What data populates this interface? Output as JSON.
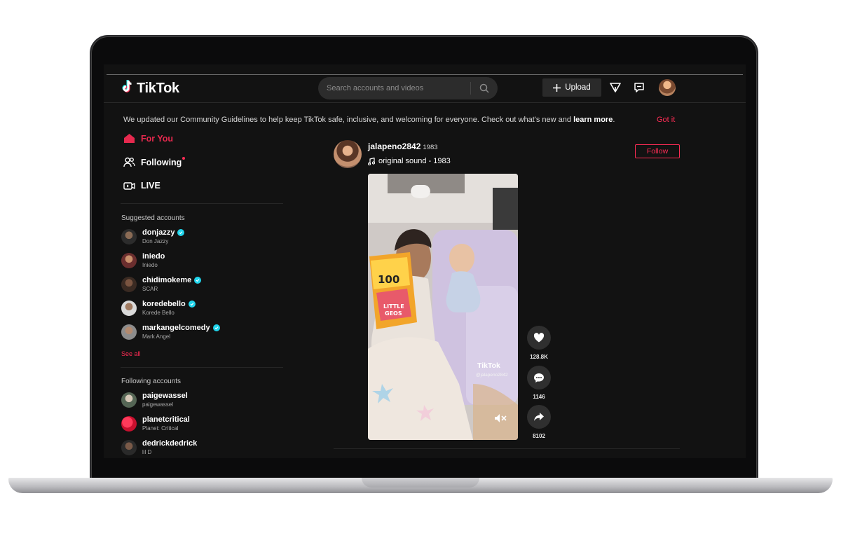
{
  "app": {
    "name": "TikTok"
  },
  "header": {
    "search_placeholder": "Search accounts and videos",
    "upload_label": "Upload"
  },
  "banner": {
    "text": "We updated our Community Guidelines to help keep TikTok safe, inclusive, and welcoming for everyone. Check out what's new and ",
    "link": "learn more",
    "dismiss": "Got it"
  },
  "nav": {
    "items": [
      {
        "label": "For You",
        "icon": "home-icon",
        "active": true
      },
      {
        "label": "Following",
        "icon": "people-icon",
        "has_dot": true
      },
      {
        "label": "LIVE",
        "icon": "live-icon"
      }
    ]
  },
  "suggested": {
    "title": "Suggested accounts",
    "accounts": [
      {
        "username": "donjazzy",
        "name": "Don Jazzy",
        "verified": true
      },
      {
        "username": "iniedo",
        "name": "Iniedo",
        "verified": false
      },
      {
        "username": "chidimokeme",
        "name": "SCAR",
        "verified": true
      },
      {
        "username": "koredebello",
        "name": "Korede Bello",
        "verified": true
      },
      {
        "username": "markangelcomedy",
        "name": "Mark Angel",
        "verified": true
      }
    ],
    "see_all": "See all"
  },
  "following": {
    "title": "Following accounts",
    "accounts": [
      {
        "username": "paigewassel",
        "name": "paigewassel"
      },
      {
        "username": "planetcritical",
        "name": "Planet: Critical"
      },
      {
        "username": "dedrickdedrick",
        "name": "lil D"
      }
    ]
  },
  "post": {
    "username": "jalapeno2842",
    "display_name": "1983",
    "sound": "original sound - 1983",
    "follow_label": "Follow",
    "watermark": "TikTok",
    "watermark_user": "@jalapeno2842",
    "likes": "128.8K",
    "comments": "1146",
    "shares": "8102"
  },
  "colors": {
    "accent": "#fe2c55",
    "verified": "#20d5ec",
    "background": "#121212"
  }
}
